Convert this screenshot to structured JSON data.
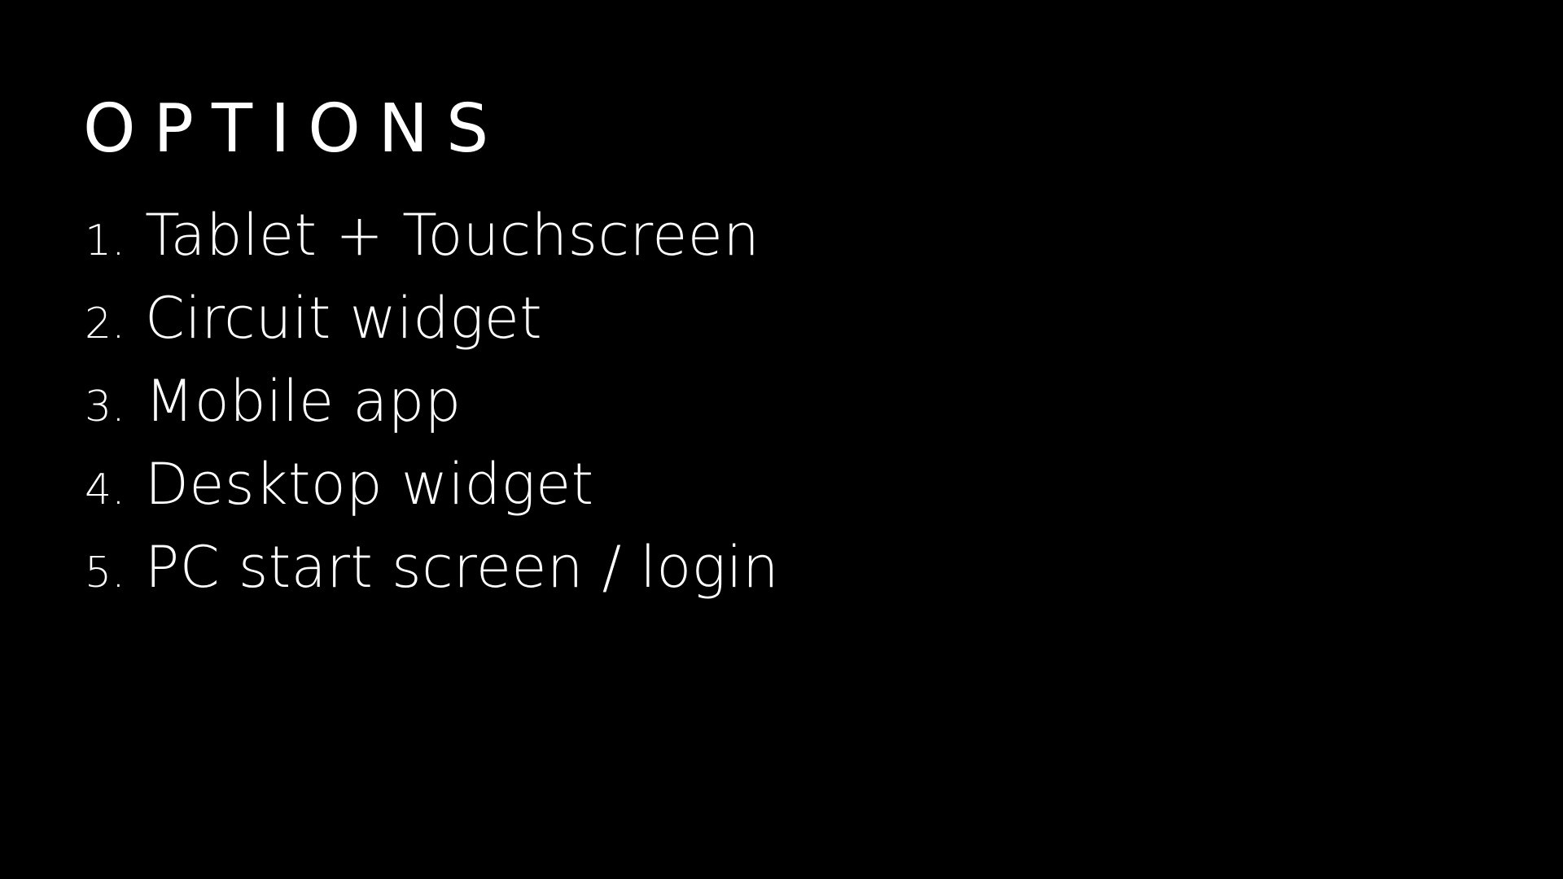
{
  "slide": {
    "title": "OPTIONS",
    "background_color": "#000000",
    "text_color": "#ffffff",
    "options": [
      {
        "number": "1.",
        "label": "Tablet + Touchscreen"
      },
      {
        "number": "2.",
        "label": "Circuit widget"
      },
      {
        "number": "3.",
        "label": "Mobile app"
      },
      {
        "number": "4.",
        "label": "Desktop widget"
      },
      {
        "number": "5.",
        "label": "PC start screen / login"
      }
    ]
  }
}
